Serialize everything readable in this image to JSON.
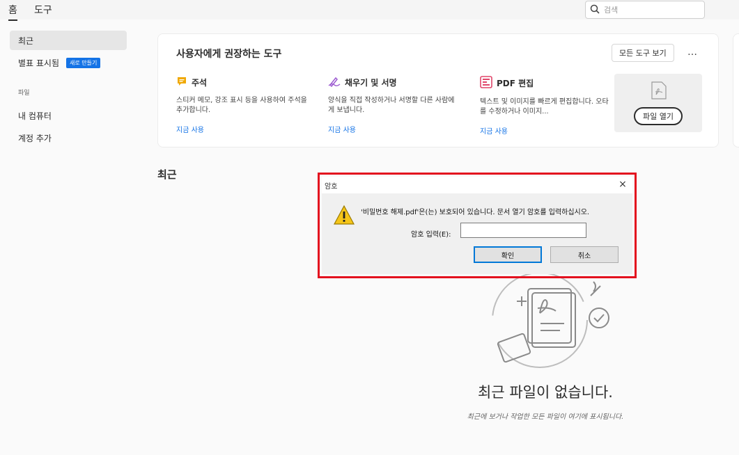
{
  "topbar": {
    "tabs": [
      {
        "label": "홈",
        "active": true
      },
      {
        "label": "도구",
        "active": false
      }
    ],
    "search": {
      "placeholder": "검색"
    }
  },
  "sidebar": {
    "items": [
      {
        "label": "최근",
        "active": true
      },
      {
        "label": "별표 표시됨",
        "badge": "새로 만들기"
      }
    ],
    "section_label": "파일",
    "file_items": [
      {
        "label": "내 컴퓨터"
      },
      {
        "label": "계정 추가"
      }
    ]
  },
  "recommended": {
    "title": "사용자에게 권장하는 도구",
    "all_tools_label": "모든 도구 보기",
    "more_label": "…",
    "tools": [
      {
        "name": "주석",
        "desc": "스티커 메모, 강조 표시 등을 사용하여 주석을 추가합니다.",
        "link": "지금 사용",
        "icon": "comment-icon",
        "color": "#f0a800"
      },
      {
        "name": "채우기 및 서명",
        "desc": "양식을 직접 작성하거나 서명할 다른 사람에게 보냅니다.",
        "link": "지금 사용",
        "icon": "fill-sign-icon",
        "color": "#9b59d0"
      },
      {
        "name": "PDF 편집",
        "desc": "텍스트 및 이미지를 빠르게 편집합니다. 오타를 수정하거나 이미지...",
        "link": "지금 사용",
        "icon": "edit-pdf-icon",
        "color": "#e0466a"
      }
    ],
    "open_file_label": "파일 열기"
  },
  "recent": {
    "heading": "최근",
    "empty_title": "최근 파일이 없습니다.",
    "empty_sub": "최근에 보거나 작업한 모든 파일이 여기에 표시됩니다."
  },
  "dialog": {
    "title": "암호",
    "message": "'비밀번호 해제.pdf'은(는) 보호되어 있습니다. 문서 열기 암호를 입력하십시오.",
    "password_label": "암호 입력(E):",
    "password_value": "",
    "ok_label": "확인",
    "cancel_label": "취소",
    "close_label": "×"
  },
  "colors": {
    "accent": "#1473e6",
    "highlight": "#e3101e"
  }
}
